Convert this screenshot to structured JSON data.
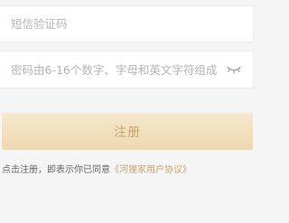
{
  "form": {
    "sms_code": {
      "value": "",
      "placeholder": "短信验证码"
    },
    "password": {
      "value": "",
      "placeholder": "密码由6-16个数字、字母和英文字符组成",
      "visibility_icon": "eye-closed-icon"
    }
  },
  "actions": {
    "register_label": "注册"
  },
  "agreement": {
    "prefix": "点击注册，即表示你已同意",
    "link_label": "《河狸家用户协议》"
  },
  "colors": {
    "page_background": "#f5f5f5",
    "field_background": "#ffffff",
    "placeholder_text": "#b5b5b5",
    "button_background": "#f2dfbc",
    "accent": "#c9a36c",
    "body_text": "#666666"
  }
}
